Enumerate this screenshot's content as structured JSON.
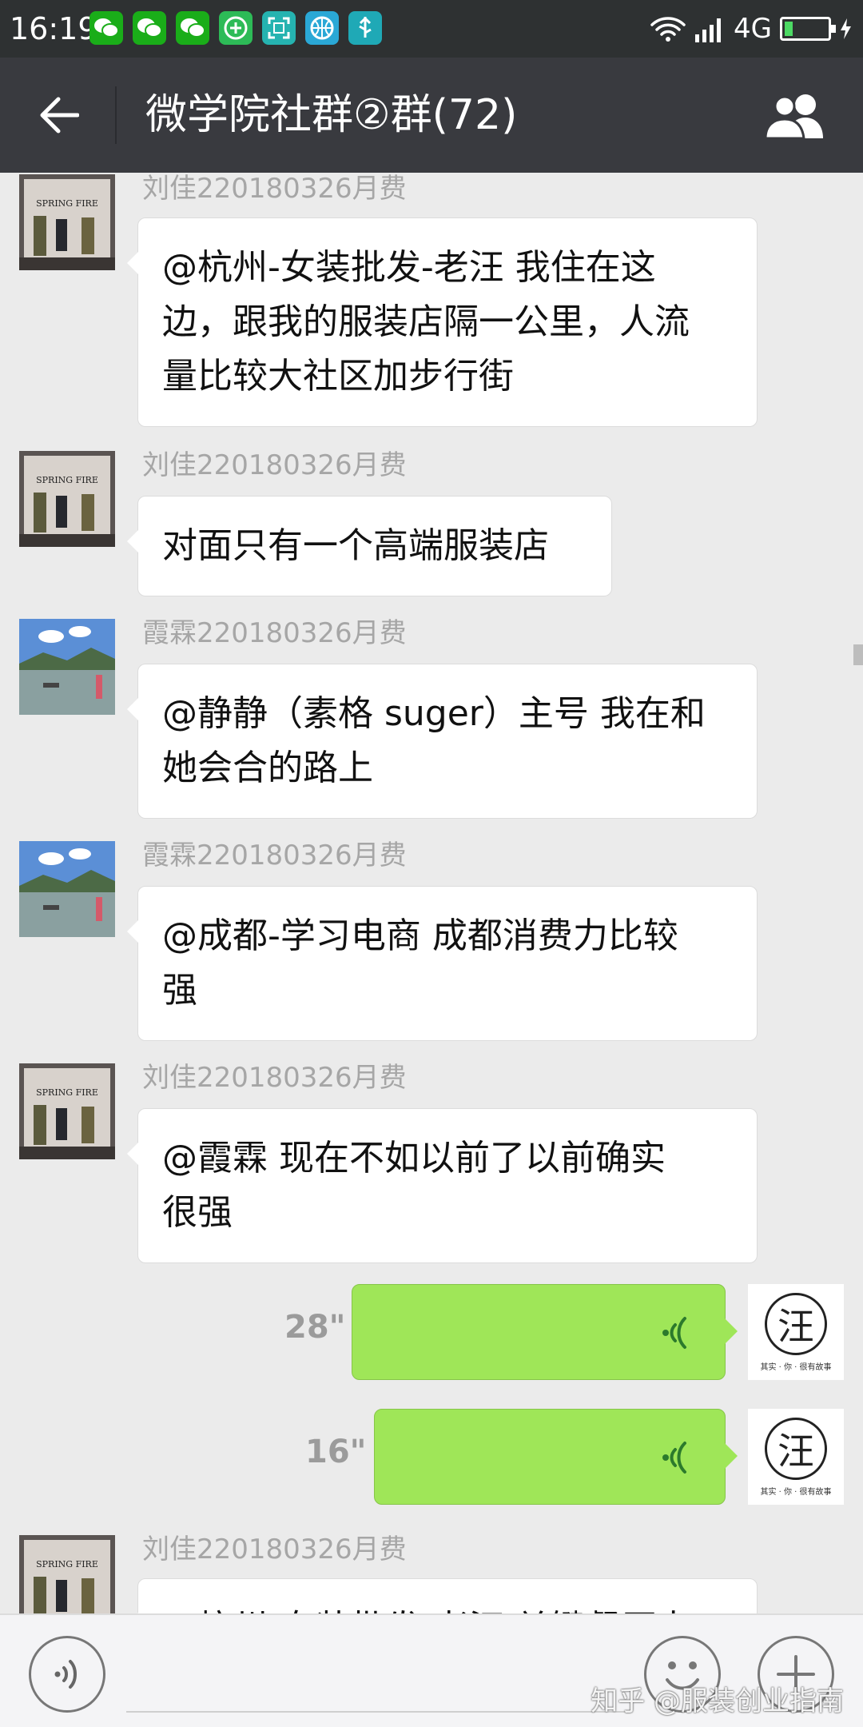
{
  "status_bar": {
    "time": "16:19",
    "network": "4G",
    "battery_level": 0.2,
    "notification_icons": [
      "wechat-icon",
      "wechat-icon",
      "wechat-icon",
      "plus-circle-icon",
      "scan-icon",
      "basketball-icon",
      "usb-icon"
    ]
  },
  "header": {
    "title": "微学院社群②群(72)"
  },
  "messages": [
    {
      "sender": "刘佳220180326月费",
      "avatar": "spring-fire-store-avatar",
      "lines": [
        "@杭州-女装批发-老汪  我住在这",
        "边，跟我的服装店隔一公里，人流",
        "量比较大社区加步行街"
      ]
    },
    {
      "sender": "刘佳220180326月费",
      "avatar": "spring-fire-store-avatar",
      "lines": [
        "对面只有一个高端服装店"
      ]
    },
    {
      "sender": "霞霖220180326月费",
      "avatar": "lake-photo-avatar",
      "lines": [
        "@静静（素格 suger）主号  我在和",
        "她会合的路上"
      ]
    },
    {
      "sender": "霞霖220180326月费",
      "avatar": "lake-photo-avatar",
      "lines": [
        "@成都-学习电商  成都消费力比较",
        "强"
      ]
    },
    {
      "sender": "刘佳220180326月费",
      "avatar": "spring-fire-store-avatar",
      "lines": [
        "@霞霖  现在不如以前了以前确实",
        "很强"
      ]
    },
    {
      "self": true,
      "duration": "28\"",
      "avatar_char": "汪",
      "avatar_caption": "其实 · 你 · 很有故事"
    },
    {
      "self": true,
      "duration": "16\"",
      "avatar_char": "汪",
      "avatar_caption": "其实 · 你 · 很有故事"
    },
    {
      "sender": "刘佳220180326月费",
      "avatar": "spring-fire-store-avatar",
      "lines": [
        "@杭州-女装批发-老汪  关键餐厅太"
      ]
    }
  ],
  "input_bar": {
    "watermark": "知乎 @服装创业指南"
  }
}
